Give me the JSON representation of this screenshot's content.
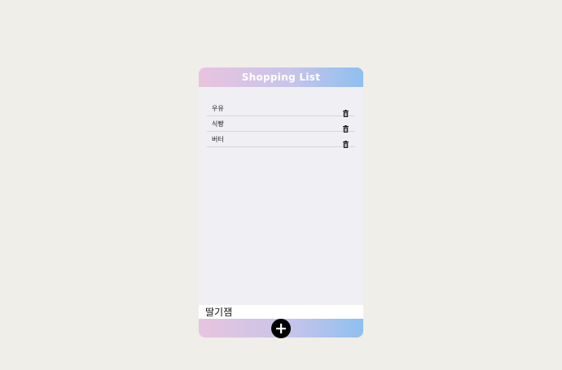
{
  "header": {
    "title": "Shopping List"
  },
  "items": [
    {
      "label": "우유",
      "icon": "trash-icon"
    },
    {
      "label": "식빵",
      "icon": "trash-icon"
    },
    {
      "label": "버터",
      "icon": "trash-icon"
    }
  ],
  "input": {
    "value": "딸기잼"
  },
  "add_button": {
    "icon": "plus-icon"
  },
  "colors": {
    "gradient_start": "#e8c4de",
    "gradient_end": "#8ec0f0",
    "background": "#efeee9",
    "panel": "#f0eff4",
    "button": "#000000"
  }
}
